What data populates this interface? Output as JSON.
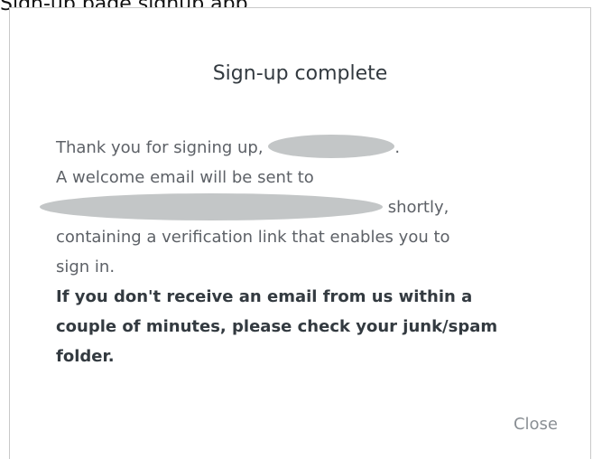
{
  "background_text": "Sign-up page signup app",
  "modal": {
    "title": "Sign-up complete",
    "line1_prefix": "Thank you for signing up,",
    "line1_suffix": ".",
    "line2": "A welcome email will be sent to",
    "line3_suffix": "shortly,",
    "line4": "containing a verification link that enables you to",
    "line5": "sign in.",
    "bold_line1": "If you don't receive an email from us within a",
    "bold_line2": "couple of minutes, please check your junk/spam",
    "bold_line3": "folder.",
    "close_label": "Close"
  },
  "colors": {
    "redaction": "#c3c6c7",
    "border": "#c9c9c9",
    "close_text": "#8a8f94"
  }
}
